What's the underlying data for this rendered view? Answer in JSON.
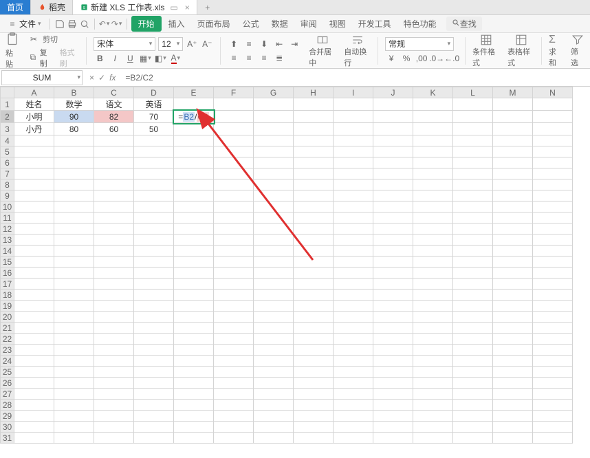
{
  "tabs": {
    "t1": "首页",
    "t2": "稻壳",
    "t3": "新建 XLS 工作表.xls"
  },
  "file_menu": "文件",
  "menus": {
    "start": "开始",
    "insert": "插入",
    "layout": "页面布局",
    "formula": "公式",
    "data": "数据",
    "review": "审阅",
    "view": "视图",
    "dev": "开发工具",
    "special": "特色功能",
    "search": "查找"
  },
  "ribbon": {
    "paste": "粘贴",
    "cut": "剪切",
    "copy": "复制",
    "fmtpaint": "格式刷",
    "font": "宋体",
    "fontsize": "12",
    "merge": "合并居中",
    "wrap": "自动换行",
    "numfmt": "常规",
    "condfmt": "条件格式",
    "tablefmt": "表格样式",
    "sum": "求和",
    "filter": "筛选"
  },
  "name_box": "SUM",
  "formula_bar": "=B2/C2",
  "cols": [
    "A",
    "B",
    "C",
    "D",
    "E",
    "F",
    "G",
    "H",
    "I",
    "J",
    "K",
    "L",
    "M",
    "N"
  ],
  "rows": [
    "1",
    "2",
    "3",
    "4",
    "5",
    "6",
    "7",
    "8",
    "9",
    "10",
    "11",
    "12",
    "13",
    "14",
    "15",
    "16",
    "17",
    "18",
    "19",
    "20",
    "21",
    "22",
    "23",
    "24",
    "25",
    "26",
    "27",
    "28",
    "29",
    "30",
    "31"
  ],
  "data_cells": {
    "r1": {
      "A": "姓名",
      "B": "数学",
      "C": "语文",
      "D": "英语"
    },
    "r2": {
      "A": "小明",
      "B": "90",
      "C": "82",
      "D": "70"
    },
    "r3": {
      "A": "小丹",
      "B": "80",
      "C": "60",
      "D": "50"
    }
  },
  "cell_formula": {
    "eq": "=",
    "ref1": "B2",
    "slash": "/",
    "ref2": "C2"
  },
  "chart_data": {
    "type": "table",
    "columns": [
      "姓名",
      "数学",
      "语文",
      "英语"
    ],
    "rows": [
      {
        "姓名": "小明",
        "数学": 90,
        "语文": 82,
        "英语": 70
      },
      {
        "姓名": "小丹",
        "数学": 80,
        "语文": 60,
        "英语": 50
      }
    ],
    "active_formula": "=B2/C2",
    "active_cell": "E2"
  }
}
